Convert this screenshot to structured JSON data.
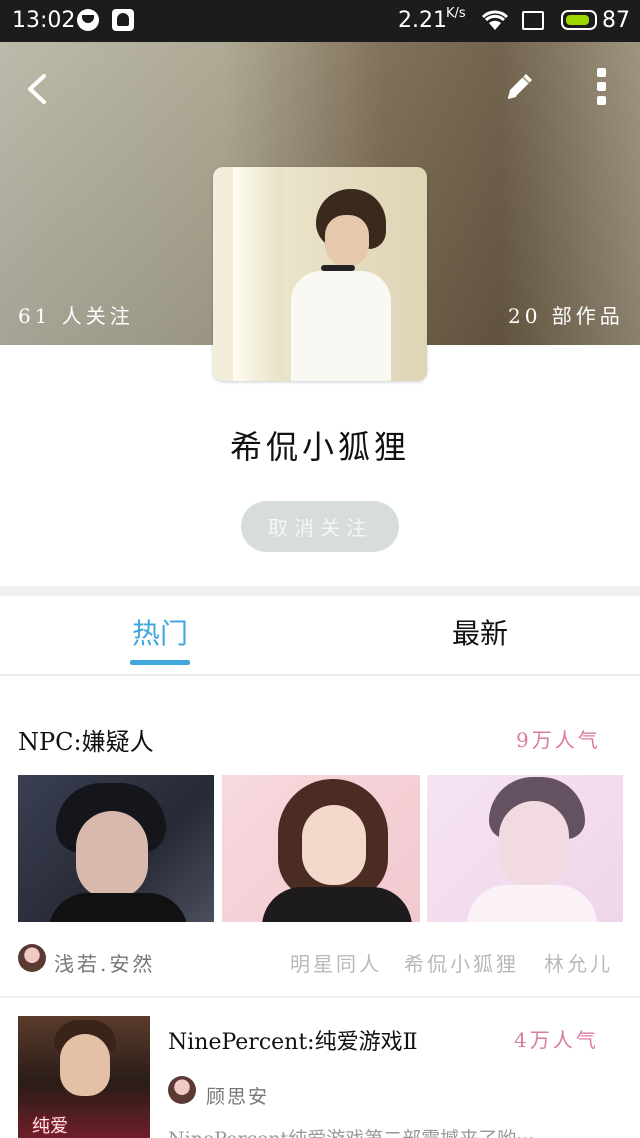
{
  "status_bar": {
    "time": "13:02",
    "speed": "2.21",
    "speed_unit": "K/s",
    "battery_pct": "87",
    "battery_level": 0.87,
    "battery_color": "#9dd700"
  },
  "header": {
    "back_icon": "chevron-left-icon",
    "edit_icon": "pencil-icon",
    "more_icon": "more-vertical-icon"
  },
  "profile": {
    "followers": "61 人关注",
    "works": "20 部作品",
    "name": "希侃小狐狸",
    "follow_button": "取消关注"
  },
  "tabs": {
    "hot": "热门",
    "latest": "最新",
    "active": "hot",
    "accent_color": "#3ea8df"
  },
  "cards": [
    {
      "title": "NPC:嫌疑人",
      "popularity": "9万人气",
      "author": "浅若.安然",
      "tags": [
        "明星同人",
        "希侃小狐狸",
        "林允儿"
      ]
    },
    {
      "title": "NinePercent:纯爱游戏Ⅱ",
      "popularity": "4万人气",
      "author": "顾思安",
      "cover_text": "纯爱",
      "description": "NinePercent纯爱游戏第二部震撼来了哟···"
    }
  ],
  "colors": {
    "popularity": "#d97aa3",
    "follow_button_bg": "#d6dddb"
  }
}
